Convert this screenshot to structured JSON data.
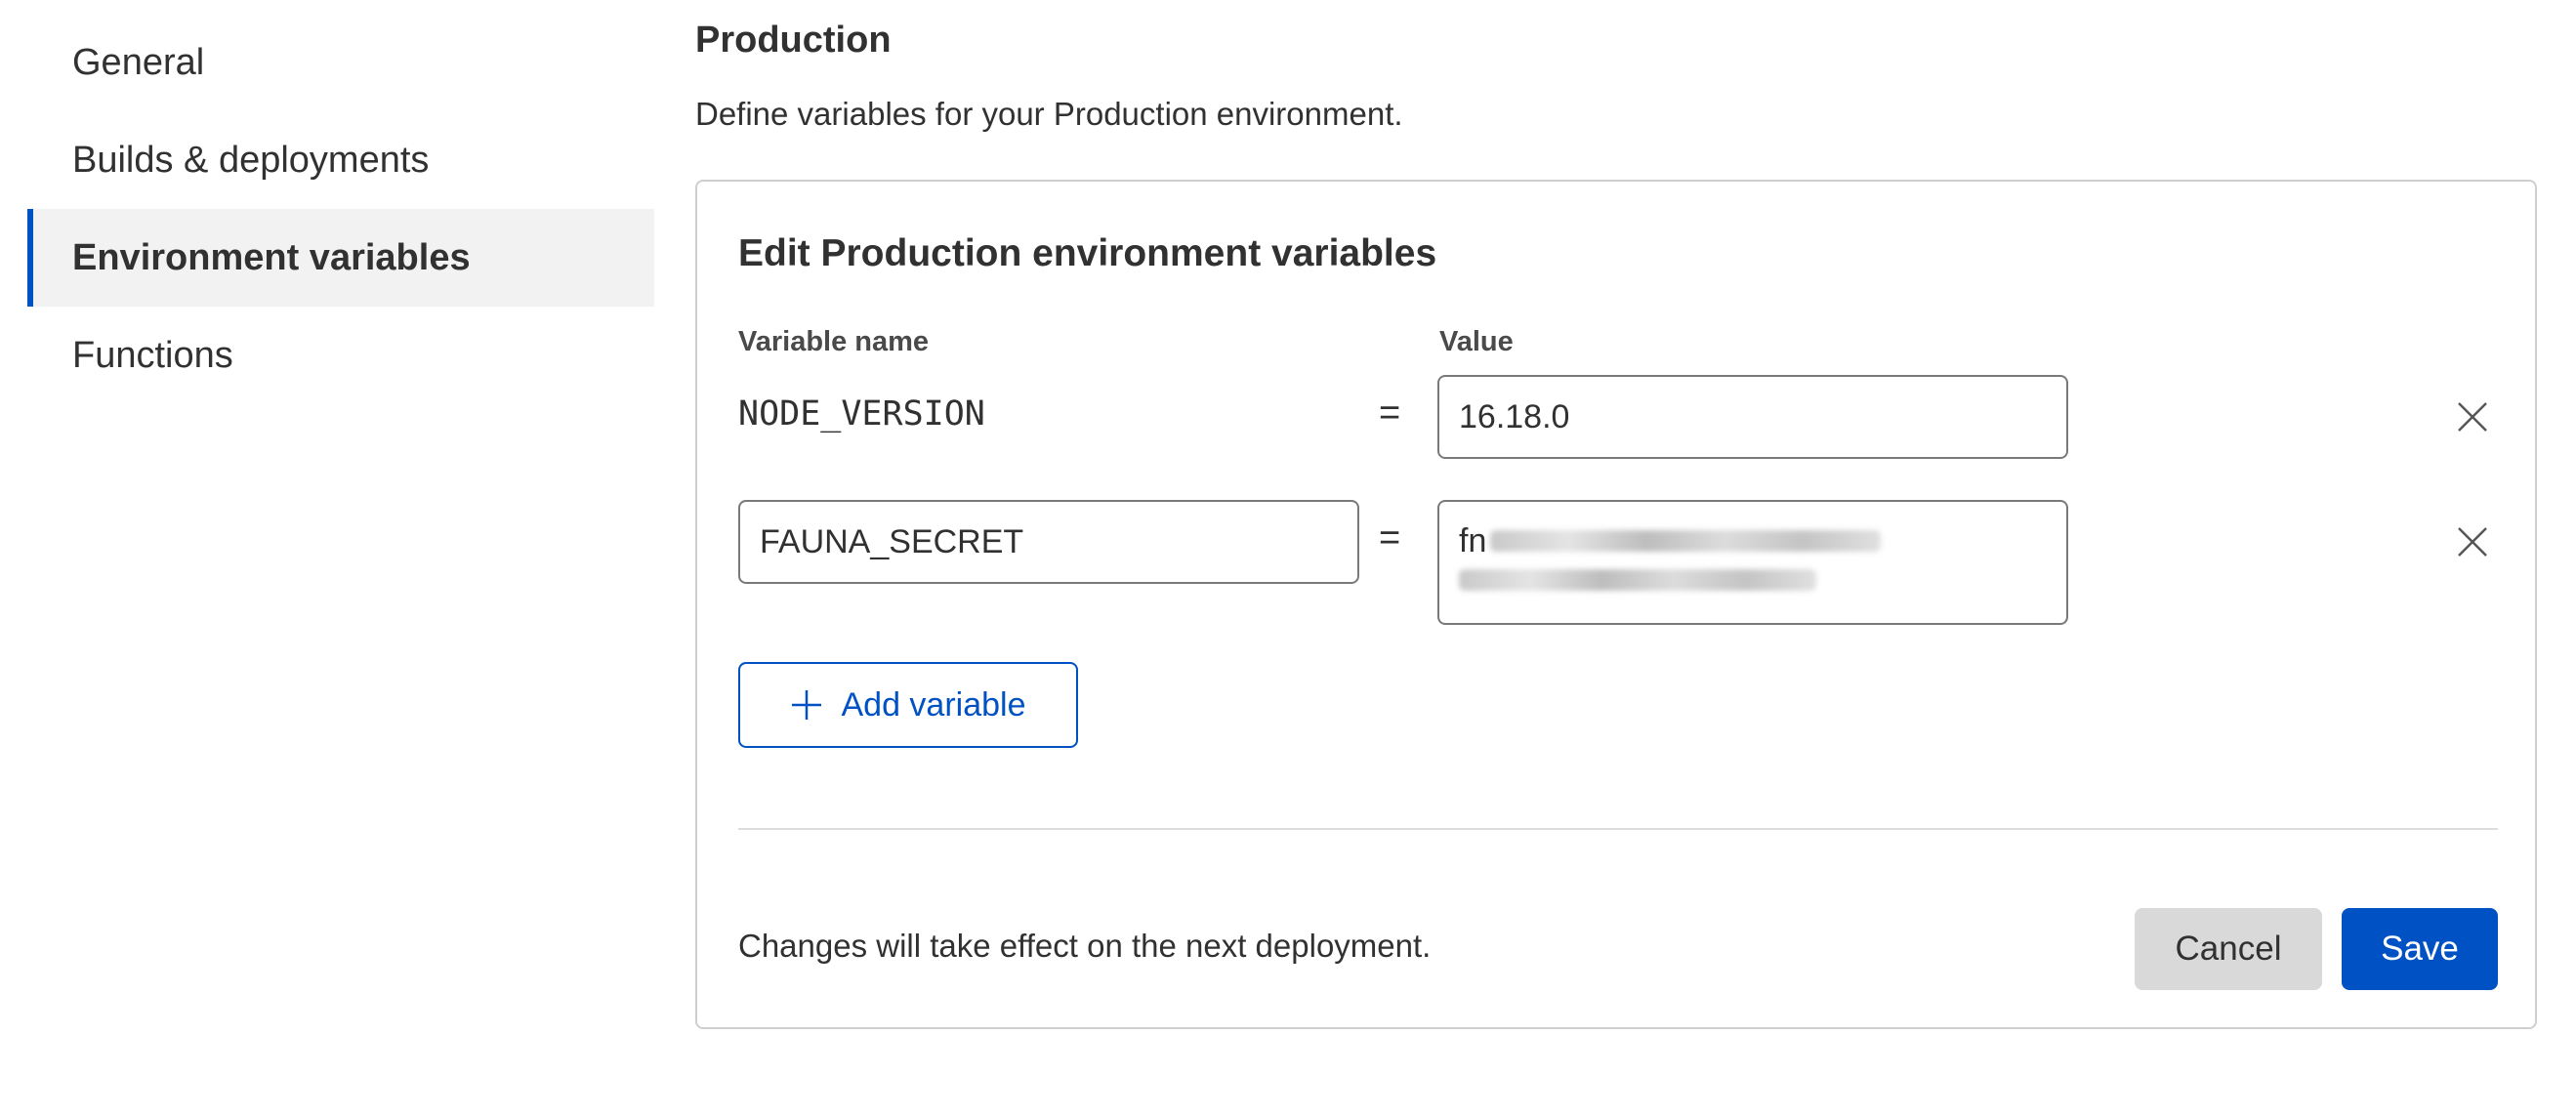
{
  "sidebar": {
    "items": [
      {
        "label": "General",
        "active": false
      },
      {
        "label": "Builds & deployments",
        "active": false
      },
      {
        "label": "Environment variables",
        "active": true
      },
      {
        "label": "Functions",
        "active": false
      }
    ]
  },
  "section": {
    "title": "Production",
    "description": "Define variables for your Production environment."
  },
  "editor": {
    "title": "Edit Production environment variables",
    "name_column_label": "Variable name",
    "value_column_label": "Value",
    "equals_sign": "=",
    "variables": [
      {
        "name": "NODE_VERSION",
        "value": "16.18.0",
        "name_editable": false
      },
      {
        "name": "FAUNA_SECRET",
        "value_visible_prefix": "fn",
        "value_obscured": true,
        "name_editable": true
      }
    ],
    "add_variable_label": "Add variable",
    "footer_note": "Changes will take effect on the next deployment.",
    "cancel_label": "Cancel",
    "save_label": "Save"
  },
  "icons": {
    "remove": "close-icon",
    "add": "plus-icon"
  },
  "colors": {
    "accent": "#0051c3",
    "active_bg": "#f2f2f2",
    "cancel_bg": "#d9d9d9",
    "text": "#313131"
  }
}
